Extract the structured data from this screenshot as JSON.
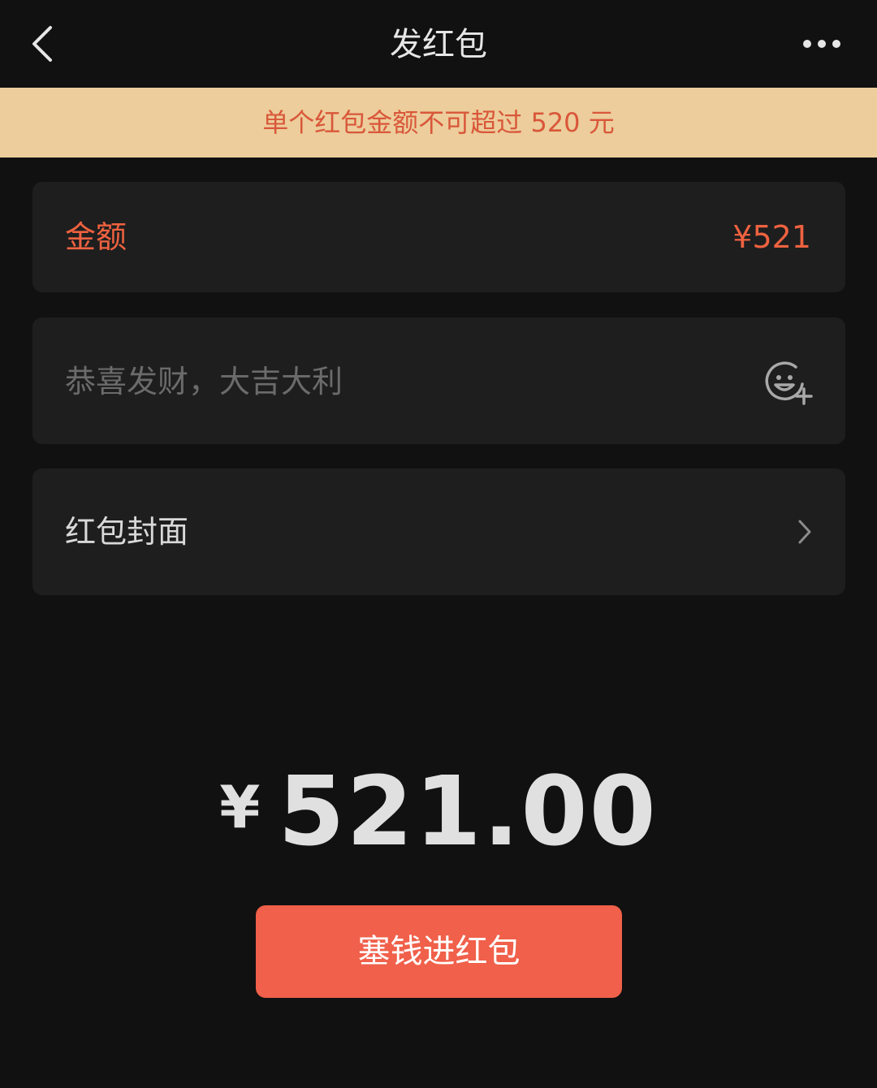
{
  "nav": {
    "title": "发红包",
    "back_icon": "chevron-left-icon",
    "more_icon": "more-horizontal-icon"
  },
  "notice": {
    "text": "单个红包金额不可超过 520 元",
    "background": "#eccd9b",
    "color": "#d9573a"
  },
  "amount": {
    "label": "金额",
    "value": "¥521",
    "color": "#ef6240"
  },
  "blessing": {
    "placeholder": "恭喜发财，大吉大利",
    "value": "",
    "emoji_icon": "emoji-add-icon"
  },
  "cover": {
    "label": "红包封面",
    "chevron_icon": "chevron-right-icon"
  },
  "total": {
    "currency": "¥",
    "value": "521.00"
  },
  "submit": {
    "label": "塞钱进红包",
    "color": "#f0604a"
  }
}
